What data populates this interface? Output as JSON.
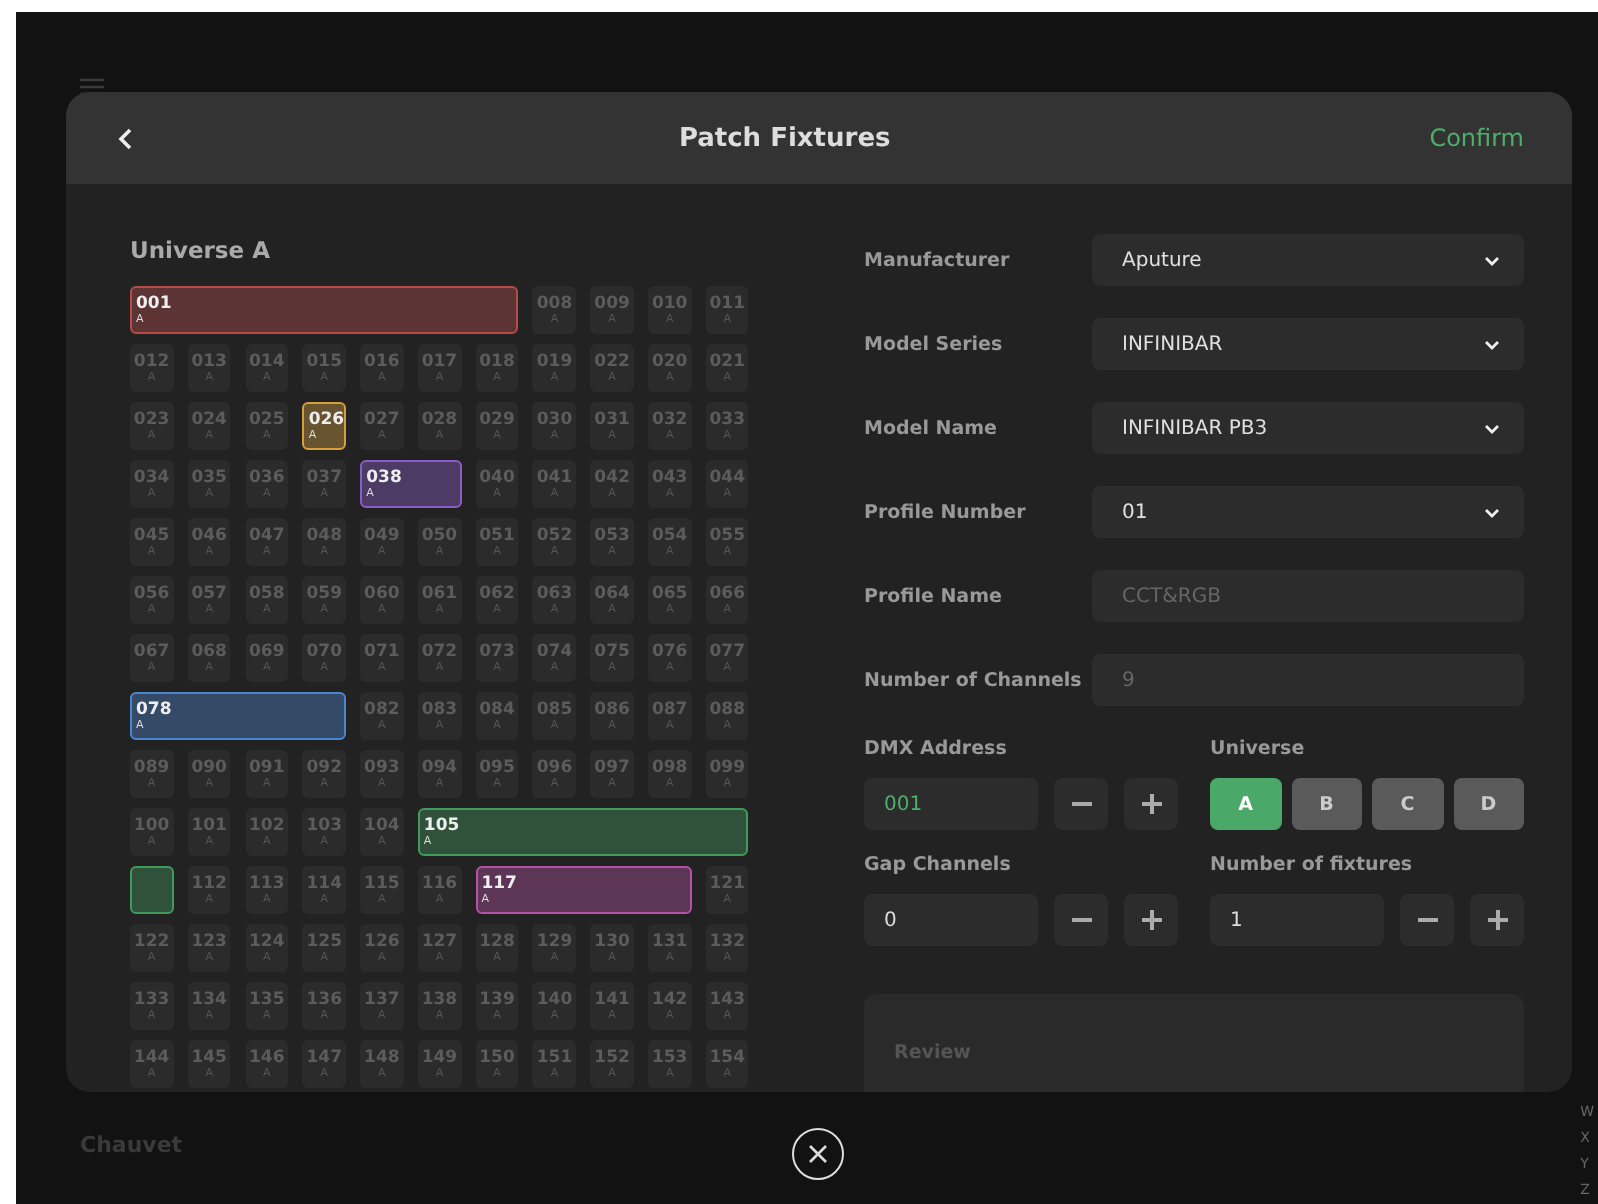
{
  "background": {
    "footer_label": "Chauvet",
    "index_letters": [
      "W",
      "X",
      "Y",
      "Z"
    ]
  },
  "dialog": {
    "title": "Patch Fixtures",
    "confirm": "Confirm",
    "universe_title": "Universe A",
    "slots": [
      {
        "label": "001",
        "sub": "A",
        "color": "#b84a4a"
      },
      {
        "label": "008",
        "sub": "A"
      },
      {
        "label": "009",
        "sub": "A"
      },
      {
        "label": "010",
        "sub": "A"
      },
      {
        "label": "011",
        "sub": "A"
      },
      {
        "label": "012",
        "sub": "A"
      },
      {
        "label": "013",
        "sub": "A"
      },
      {
        "label": "014",
        "sub": "A"
      },
      {
        "label": "015",
        "sub": "A"
      },
      {
        "label": "016",
        "sub": "A"
      },
      {
        "label": "017",
        "sub": "A"
      },
      {
        "label": "018",
        "sub": "A"
      },
      {
        "label": "019",
        "sub": "A"
      },
      {
        "label": "022",
        "sub": "A"
      },
      {
        "label": "020",
        "sub": "A"
      },
      {
        "label": "021",
        "sub": "A"
      },
      {
        "label": "023",
        "sub": "A"
      },
      {
        "label": "024",
        "sub": "A"
      },
      {
        "label": "025",
        "sub": "A"
      },
      {
        "label": "026",
        "sub": "A",
        "color": "#d4a03c"
      },
      {
        "label": "027",
        "sub": "A"
      },
      {
        "label": "028",
        "sub": "A"
      },
      {
        "label": "029",
        "sub": "A"
      },
      {
        "label": "030",
        "sub": "A"
      },
      {
        "label": "031",
        "sub": "A"
      },
      {
        "label": "032",
        "sub": "A"
      },
      {
        "label": "033",
        "sub": "A"
      },
      {
        "label": "034",
        "sub": "A"
      },
      {
        "label": "035",
        "sub": "A"
      },
      {
        "label": "036",
        "sub": "A"
      },
      {
        "label": "037",
        "sub": "A"
      },
      {
        "label": "038",
        "sub": "A",
        "color": "#8a5cc8"
      },
      {
        "label": "040",
        "sub": "A"
      },
      {
        "label": "041",
        "sub": "A"
      },
      {
        "label": "042",
        "sub": "A"
      },
      {
        "label": "043",
        "sub": "A"
      },
      {
        "label": "044",
        "sub": "A"
      },
      {
        "label": "045",
        "sub": "A"
      },
      {
        "label": "046",
        "sub": "A"
      },
      {
        "label": "047",
        "sub": "A"
      },
      {
        "label": "048",
        "sub": "A"
      },
      {
        "label": "049",
        "sub": "A"
      },
      {
        "label": "050",
        "sub": "A"
      },
      {
        "label": "051",
        "sub": "A"
      },
      {
        "label": "052",
        "sub": "A"
      },
      {
        "label": "053",
        "sub": "A"
      },
      {
        "label": "054",
        "sub": "A"
      },
      {
        "label": "055",
        "sub": "A"
      },
      {
        "label": "056",
        "sub": "A"
      },
      {
        "label": "057",
        "sub": "A"
      },
      {
        "label": "058",
        "sub": "A"
      },
      {
        "label": "059",
        "sub": "A"
      },
      {
        "label": "060",
        "sub": "A"
      },
      {
        "label": "061",
        "sub": "A"
      },
      {
        "label": "062",
        "sub": "A"
      },
      {
        "label": "063",
        "sub": "A"
      },
      {
        "label": "064",
        "sub": "A"
      },
      {
        "label": "065",
        "sub": "A"
      },
      {
        "label": "066",
        "sub": "A"
      },
      {
        "label": "067",
        "sub": "A"
      },
      {
        "label": "068",
        "sub": "A"
      },
      {
        "label": "069",
        "sub": "A"
      },
      {
        "label": "070",
        "sub": "A"
      },
      {
        "label": "071",
        "sub": "A"
      },
      {
        "label": "072",
        "sub": "A"
      },
      {
        "label": "073",
        "sub": "A"
      },
      {
        "label": "074",
        "sub": "A"
      },
      {
        "label": "075",
        "sub": "A"
      },
      {
        "label": "076",
        "sub": "A"
      },
      {
        "label": "077",
        "sub": "A"
      },
      {
        "label": "078",
        "sub": "A",
        "color": "#4a86d0"
      },
      {
        "label": "082",
        "sub": "A"
      },
      {
        "label": "083",
        "sub": "A"
      },
      {
        "label": "084",
        "sub": "A"
      },
      {
        "label": "085",
        "sub": "A"
      },
      {
        "label": "086",
        "sub": "A"
      },
      {
        "label": "087",
        "sub": "A"
      },
      {
        "label": "088",
        "sub": "A"
      },
      {
        "label": "089",
        "sub": "A"
      },
      {
        "label": "090",
        "sub": "A"
      },
      {
        "label": "091",
        "sub": "A"
      },
      {
        "label": "092",
        "sub": "A"
      },
      {
        "label": "093",
        "sub": "A"
      },
      {
        "label": "094",
        "sub": "A"
      },
      {
        "label": "095",
        "sub": "A"
      },
      {
        "label": "096",
        "sub": "A"
      },
      {
        "label": "097",
        "sub": "A"
      },
      {
        "label": "098",
        "sub": "A"
      },
      {
        "label": "099",
        "sub": "A"
      },
      {
        "label": "100",
        "sub": "A"
      },
      {
        "label": "101",
        "sub": "A"
      },
      {
        "label": "102",
        "sub": "A"
      },
      {
        "label": "103",
        "sub": "A"
      },
      {
        "label": "104",
        "sub": "A"
      },
      {
        "label": "105",
        "sub": "A",
        "color": "#3f9a5c"
      },
      {
        "color": "#3f9a5c"
      },
      {
        "label": "112",
        "sub": "A"
      },
      {
        "label": "113",
        "sub": "A"
      },
      {
        "label": "114",
        "sub": "A"
      },
      {
        "label": "115",
        "sub": "A"
      },
      {
        "label": "116",
        "sub": "A"
      },
      {
        "label": "117",
        "sub": "A",
        "color": "#b850a8"
      },
      {
        "label": "121",
        "sub": "A"
      },
      {
        "label": "122",
        "sub": "A"
      },
      {
        "label": "123",
        "sub": "A"
      },
      {
        "label": "124",
        "sub": "A"
      },
      {
        "label": "125",
        "sub": "A"
      },
      {
        "label": "126",
        "sub": "A"
      },
      {
        "label": "127",
        "sub": "A"
      },
      {
        "label": "128",
        "sub": "A"
      },
      {
        "label": "129",
        "sub": "A"
      },
      {
        "label": "130",
        "sub": "A"
      },
      {
        "label": "131",
        "sub": "A"
      },
      {
        "label": "132",
        "sub": "A"
      },
      {
        "label": "133",
        "sub": "A"
      },
      {
        "label": "134",
        "sub": "A"
      },
      {
        "label": "135",
        "sub": "A"
      },
      {
        "label": "136",
        "sub": "A"
      },
      {
        "label": "137",
        "sub": "A"
      },
      {
        "label": "138",
        "sub": "A"
      },
      {
        "label": "139",
        "sub": "A"
      },
      {
        "label": "140",
        "sub": "A"
      },
      {
        "label": "141",
        "sub": "A"
      },
      {
        "label": "142",
        "sub": "A"
      },
      {
        "label": "143",
        "sub": "A"
      },
      {
        "label": "144",
        "sub": "A"
      },
      {
        "label": "145",
        "sub": "A"
      },
      {
        "label": "146",
        "sub": "A"
      },
      {
        "label": "147",
        "sub": "A"
      },
      {
        "label": "148",
        "sub": "A"
      },
      {
        "label": "149",
        "sub": "A"
      },
      {
        "label": "150",
        "sub": "A"
      },
      {
        "label": "151",
        "sub": "A"
      },
      {
        "label": "152",
        "sub": "A"
      },
      {
        "label": "153",
        "sub": "A"
      },
      {
        "label": "154",
        "sub": "A"
      }
    ],
    "fields": [
      {
        "label": "Manufacturer",
        "value": "Aputure",
        "kind": "select"
      },
      {
        "label": "Model Series",
        "value": "INFINIBAR",
        "kind": "select"
      },
      {
        "label": "Model Name",
        "value": "INFINIBAR PB3",
        "kind": "select"
      },
      {
        "label": "Profile Number",
        "value": "01",
        "kind": "select"
      },
      {
        "label": "Profile Name",
        "value": "CCT&RGB",
        "kind": "text",
        "disabled": true
      },
      {
        "label": "Number of Channels",
        "value": "9",
        "kind": "text",
        "disabled": true
      }
    ],
    "dmx_address": {
      "label": "DMX Address",
      "value": "001"
    },
    "universe": {
      "label": "Universe",
      "options": [
        {
          "label": "A",
          "selected": true
        },
        {
          "label": "B",
          "selected": false
        },
        {
          "label": "C",
          "selected": false
        },
        {
          "label": "D",
          "selected": false
        }
      ]
    },
    "gap_channels": {
      "label": "Gap Channels",
      "value": "0"
    },
    "fixture_count": {
      "label": "Number of fixtures",
      "value": "1"
    },
    "review": "Review"
  }
}
